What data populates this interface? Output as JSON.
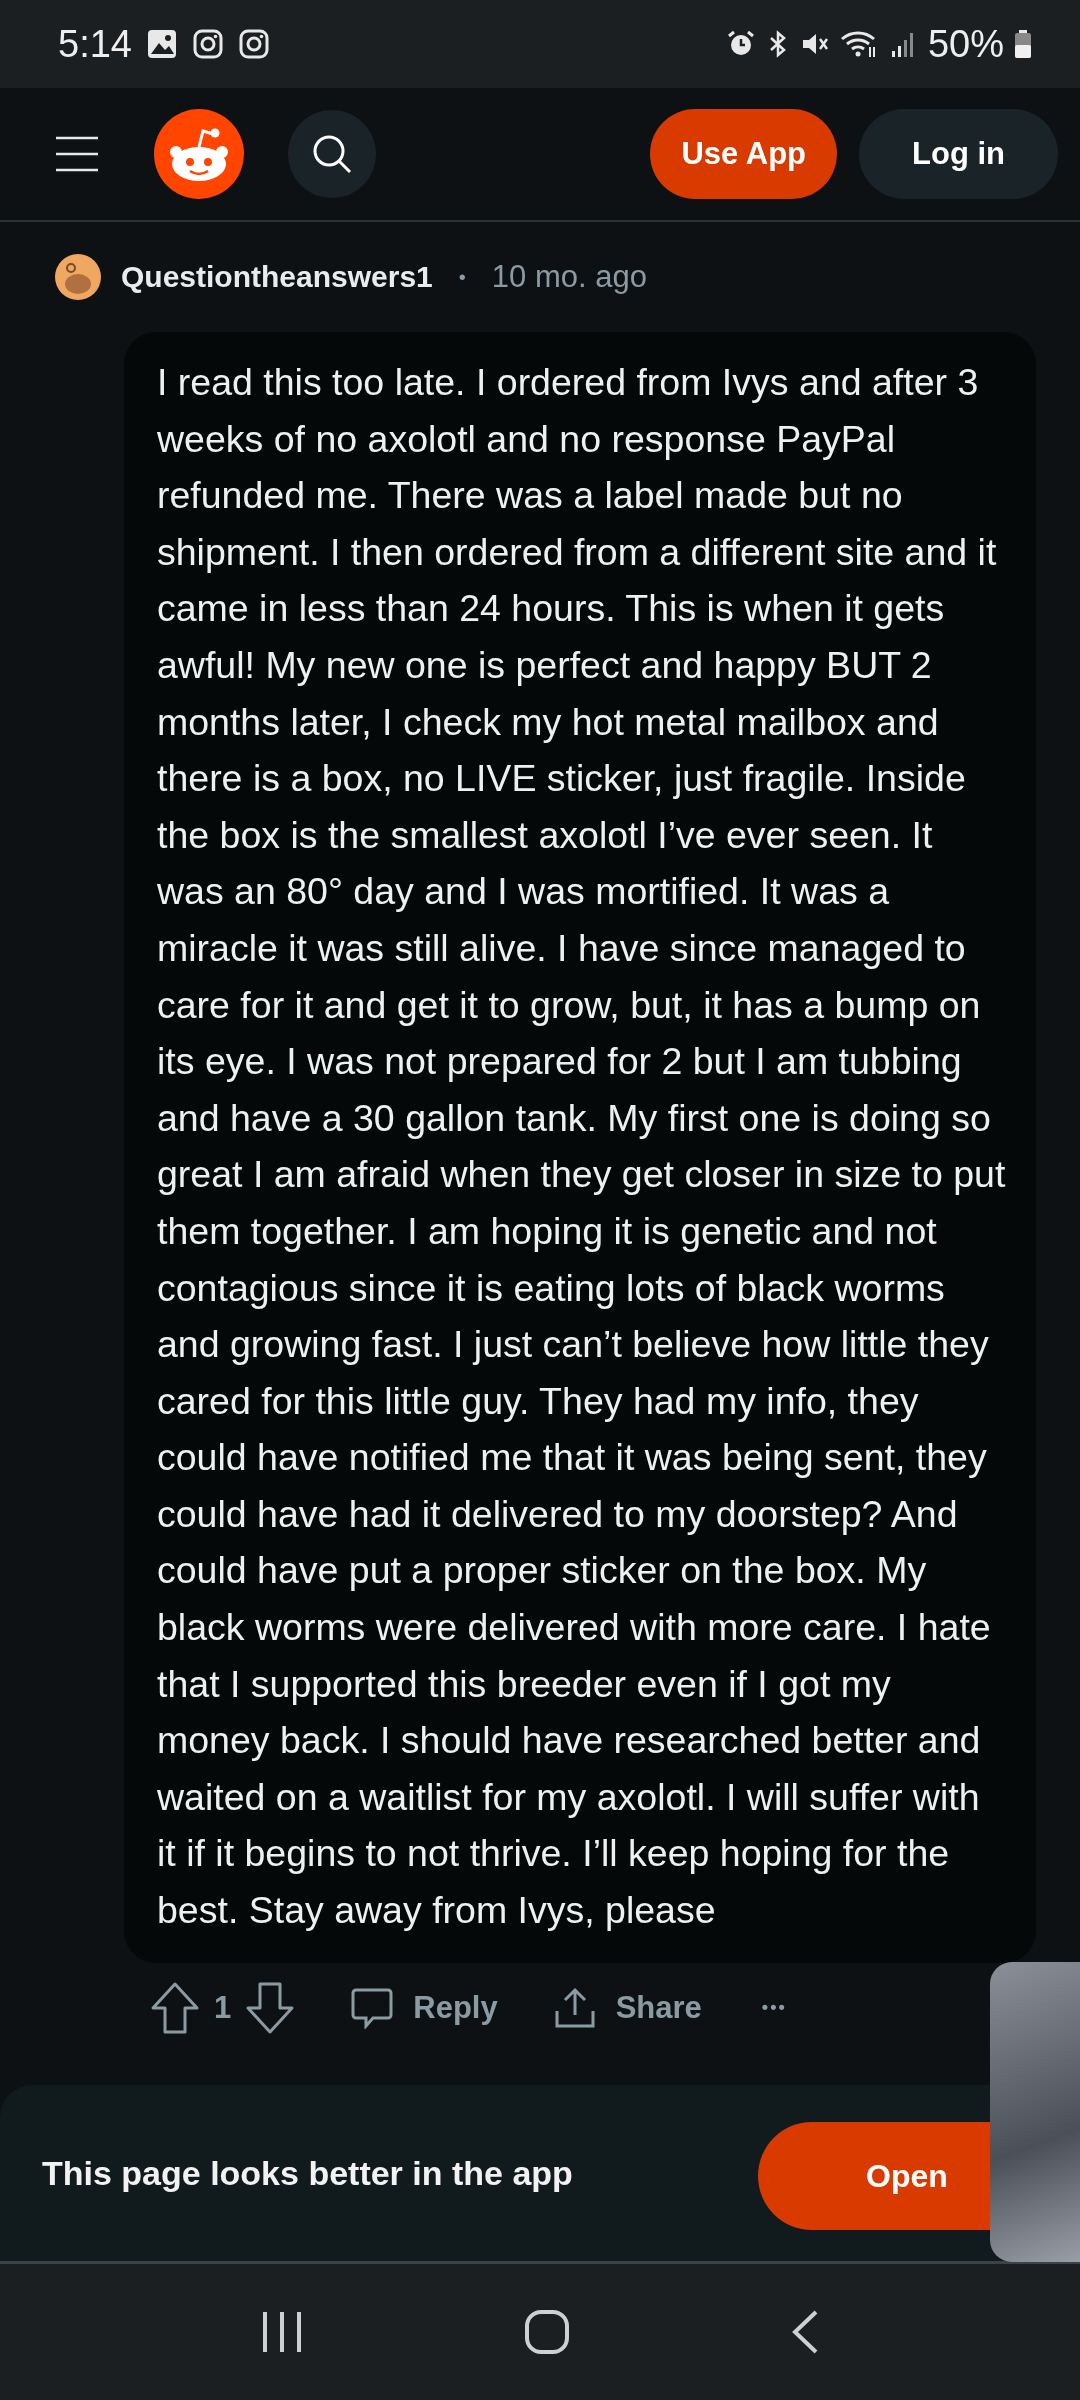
{
  "status_bar": {
    "time": "5:14",
    "battery": "50%"
  },
  "header": {
    "use_app": "Use App",
    "login": "Log in"
  },
  "comment": {
    "author": "Questiontheanswers1",
    "separator": "•",
    "age": "10 mo. ago",
    "body": "I read this too late. I ordered from Ivys and after 3 weeks of no axolotl and no response PayPal refunded me. There was a label made but no shipment. I then ordered from a different site and it came in less than 24 hours. This is when it gets awful! My new one is perfect and happy BUT 2 months later, I check my hot metal mailbox and there is a box, no LIVE sticker, just fragile. Inside the box is the smallest axolotl I’ve ever seen. It was an 80° day and I was mortified. It was a miracle it was still alive. I have since managed to care for it and get it to grow, but, it has a bump on its eye. I was not prepared for 2 but I am tubbing and have a 30 gallon tank. My first one is doing so great I am afraid when they get closer in size to put them together. I am hoping it is genetic and not contagious since it is eating lots of black worms and growing fast. I just can’t believe how little they cared for this little guy. They had my info, they could have notified me that it was being sent, they could have had it delivered to my doorstep? And could have put a proper sticker on the box. My black worms were delivered with more care. I hate that I supported this breeder even if I got my money back. I should have researched better and waited on a waitlist for my axolotl. I will suffer with it if it begins to not thrive. I’ll keep hoping for the best. Stay away from Ivys, please",
    "votes": "1",
    "reply": "Reply",
    "share": "Share",
    "more": "•••"
  },
  "banner": {
    "text": "This page looks better in the app",
    "button": "Open"
  }
}
